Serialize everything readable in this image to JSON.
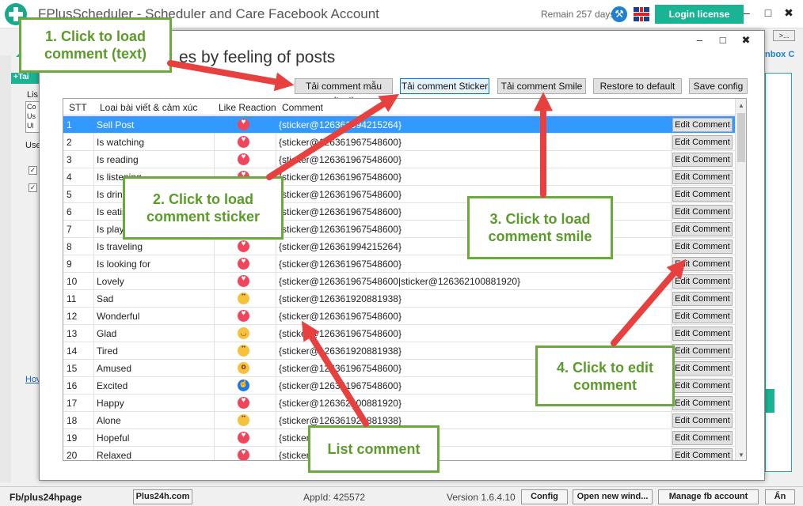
{
  "window": {
    "title": "FPlusScheduler - Scheduler and Care Facebook Account",
    "remain": "Remain 257 days",
    "login_label": "Login license",
    "minimize": "–",
    "maximize": "□",
    "close": "✖"
  },
  "background": {
    "tab_label": "+Tai",
    "list_label": "Lis",
    "list_lines": [
      "Co",
      "Us",
      "Ul"
    ],
    "use_label": "Use",
    "how_link": "Hov",
    "arrow_button": ">...",
    "inbox_label": "nbox C"
  },
  "dialog": {
    "title": "es by feeling of posts",
    "buttons": {
      "load_text": "Tải comment mẫu (text)",
      "load_sticker": "Tải comment Sticker",
      "load_smile": "Tải comment Smile",
      "restore": "Restore to default",
      "save": "Save config"
    },
    "columns": [
      "STT",
      "Loại bài viết & cảm xúc",
      "Like Reaction",
      "Comment"
    ],
    "edit_label": "Edit Comment",
    "rows": [
      {
        "stt": "1",
        "type": "Sell Post",
        "reaction": "heart",
        "comment": "{sticker@126361994215264}"
      },
      {
        "stt": "2",
        "type": "Is watching",
        "reaction": "heart",
        "comment": "{sticker@126361967548600}"
      },
      {
        "stt": "3",
        "type": "Is reading",
        "reaction": "heart",
        "comment": "{sticker@126361967548600}"
      },
      {
        "stt": "4",
        "type": "Is listening",
        "reaction": "heart",
        "comment": "{sticker@126361967548600}"
      },
      {
        "stt": "5",
        "type": "Is drinking",
        "reaction": "heart",
        "comment": "{sticker@126361967548600}"
      },
      {
        "stt": "6",
        "type": "Is eating",
        "reaction": "heart",
        "comment": "{sticker@126361967548600}"
      },
      {
        "stt": "7",
        "type": "Is playing",
        "reaction": "heart",
        "comment": "{sticker@126361967548600}"
      },
      {
        "stt": "8",
        "type": "Is traveling",
        "reaction": "heart",
        "comment": "{sticker@126361994215264}"
      },
      {
        "stt": "9",
        "type": "Is looking for",
        "reaction": "heart",
        "comment": "{sticker@126361967548600}"
      },
      {
        "stt": "10",
        "type": "Lovely",
        "reaction": "heart",
        "comment": "{sticker@126361967548600|sticker@126362100881920}"
      },
      {
        "stt": "11",
        "type": "Sad",
        "reaction": "sad",
        "comment": "{sticker@126361920881938}"
      },
      {
        "stt": "12",
        "type": "Wonderful",
        "reaction": "heart",
        "comment": "{sticker@126361967548600}"
      },
      {
        "stt": "13",
        "type": "Glad",
        "reaction": "haha",
        "comment": "{sticker@126361967548600}"
      },
      {
        "stt": "14",
        "type": "Tired",
        "reaction": "sad",
        "comment": "{sticker@126361920881938}"
      },
      {
        "stt": "15",
        "type": "Amused",
        "reaction": "wow",
        "comment": "{sticker@126361967548600}"
      },
      {
        "stt": "16",
        "type": "Excited",
        "reaction": "like",
        "comment": "{sticker@126361967548600}"
      },
      {
        "stt": "17",
        "type": "Happy",
        "reaction": "heart",
        "comment": "{sticker@126362100881920}"
      },
      {
        "stt": "18",
        "type": "Alone",
        "reaction": "sad",
        "comment": "{sticker@126361920881938}"
      },
      {
        "stt": "19",
        "type": "Hopeful",
        "reaction": "heart",
        "comment": "{sticker@126361967548600}"
      },
      {
        "stt": "20",
        "type": "Relaxed",
        "reaction": "heart",
        "comment": "{sticker@126361967548600}"
      }
    ]
  },
  "callouts": {
    "c1": "1. Click to load comment (text)",
    "c2": "2. Click to load comment sticker",
    "c3": "3. Click to load comment smile",
    "c4": "4. Click to edit comment",
    "c5": "List comment"
  },
  "status": {
    "brand": "Fb/plus24hpage",
    "site": "Plus24h.com",
    "appid": "AppId: 425572",
    "version": "Version 1.6.4.10",
    "config": "Config",
    "open_window": "Open new wind...",
    "manage": "Manage fb account",
    "hide": "Ẩn"
  },
  "colors": {
    "accent": "#1ab394",
    "callout_border": "#6aaa3a",
    "arrow": "#e8403e",
    "selection": "#3399ff"
  }
}
